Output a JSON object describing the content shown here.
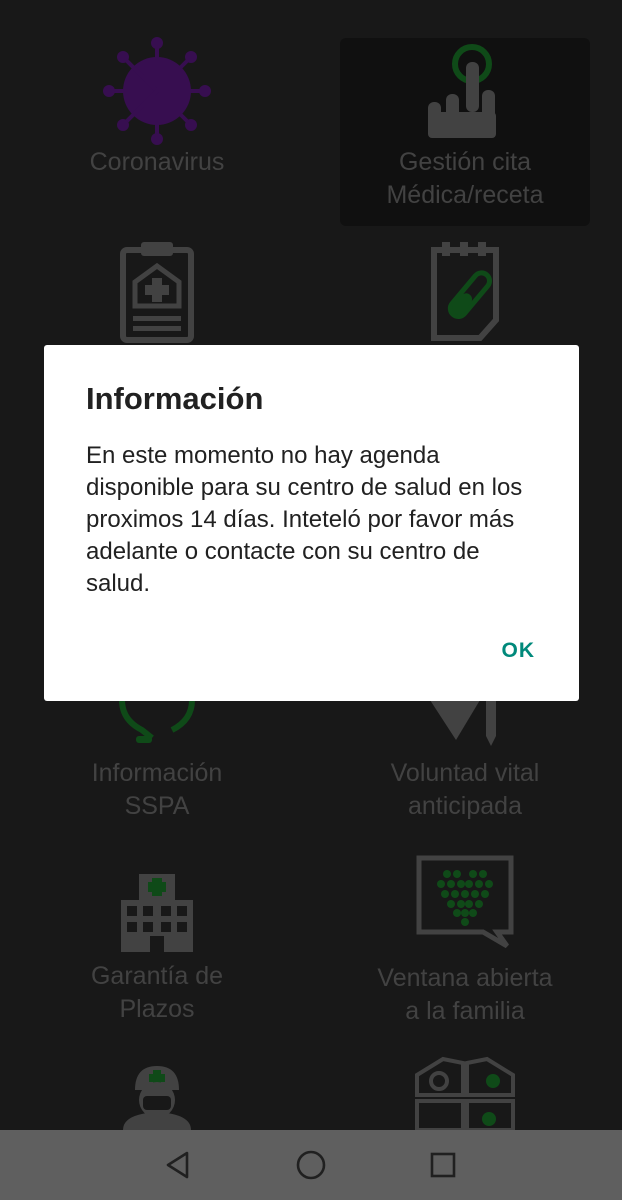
{
  "tiles": [
    {
      "label": "Coronavirus"
    },
    {
      "label": "Gestión cita\nMédica/receta"
    },
    {
      "label": "Información\nSSPA"
    },
    {
      "label": "Voluntad vital\nanticipada"
    },
    {
      "label": "Garantía de\nPlazos"
    },
    {
      "label": "Ventana abierta\na la familia"
    }
  ],
  "dialog": {
    "title": "Información",
    "message": "En este momento no hay agenda disponible para su centro de salud en los proximos 14 días. Inteteló por favor más adelante o contacte con su centro de salud.",
    "ok_label": "OK"
  },
  "colors": {
    "accent": "#00897b",
    "icon_green": "#1d8f2e",
    "icon_purple": "#6a1b9a",
    "icon_gray": "#7f7f7f",
    "label_gray": "#7f7f7f"
  },
  "navbar": {
    "icons": [
      "back-icon",
      "home-icon",
      "recents-icon"
    ]
  }
}
